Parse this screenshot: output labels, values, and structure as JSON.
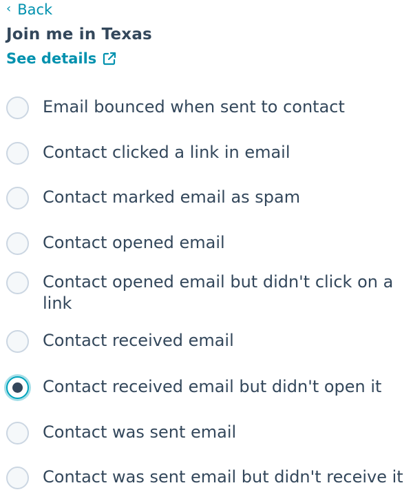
{
  "nav": {
    "back_icon": "chevron-left-icon",
    "back_label": "Back"
  },
  "header": {
    "title": "Join me in Texas",
    "details_label": "See details",
    "details_icon": "external-link-icon"
  },
  "colors": {
    "accent": "#0091ae",
    "text": "#33475b",
    "radio_border": "#cbd6e2",
    "radio_checked": "#00a4bd"
  },
  "options": {
    "selected": "Contact received email but didn't open it",
    "items": [
      {
        "label": "Email bounced when sent to contact",
        "checked": false
      },
      {
        "label": "Contact clicked a link in email",
        "checked": false
      },
      {
        "label": "Contact marked email as spam",
        "checked": false
      },
      {
        "label": "Contact opened email",
        "checked": false
      },
      {
        "label": "Contact opened email but didn't click on a link",
        "checked": false
      },
      {
        "label": "Contact received email",
        "checked": false
      },
      {
        "label": "Contact received email but didn't open it",
        "checked": true
      },
      {
        "label": "Contact was sent email",
        "checked": false
      },
      {
        "label": "Contact was sent email but didn't receive it",
        "checked": false
      }
    ]
  }
}
